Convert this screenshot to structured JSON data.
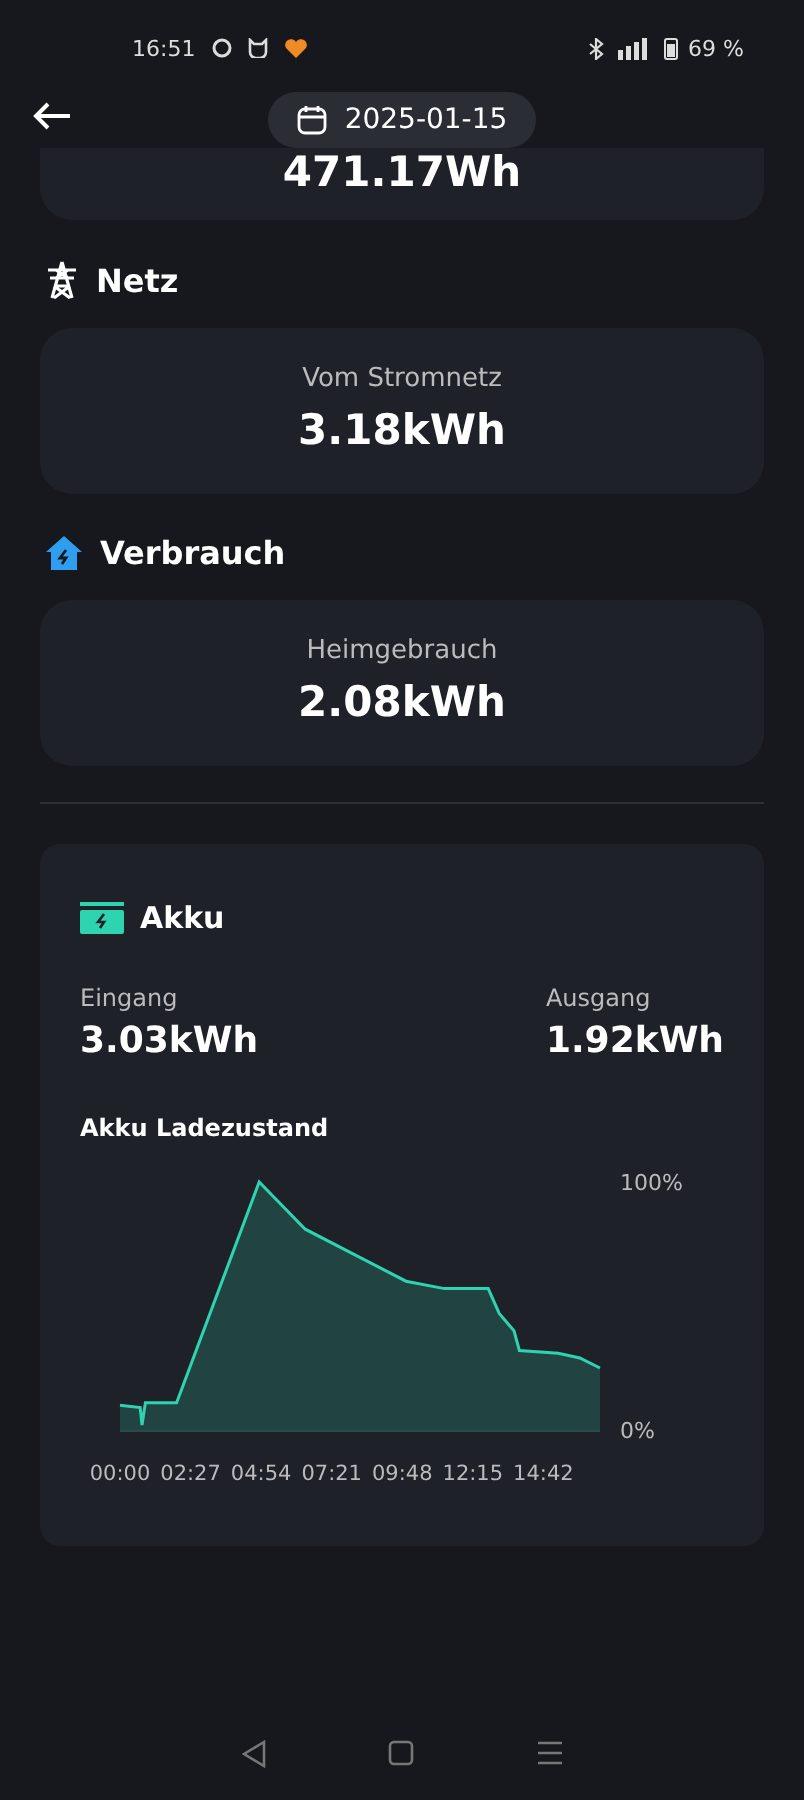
{
  "status_bar": {
    "time": "16:51",
    "battery": "69 %"
  },
  "header": {
    "date": "2025-01-15"
  },
  "top_card": {
    "value": "471.17Wh"
  },
  "sections": [
    {
      "kind": "grid",
      "title": "Netz",
      "label": "Vom Stromnetz",
      "value": "3.18kWh"
    },
    {
      "kind": "home",
      "title": "Verbrauch",
      "label": "Heimgebrauch",
      "value": "2.08kWh"
    }
  ],
  "battery": {
    "title": "Akku",
    "stats": [
      {
        "label": "Eingang",
        "value": "3.03kWh"
      },
      {
        "label": "Ausgang",
        "value": "1.92kWh"
      }
    ],
    "chart_title": "Akku Ladezustand",
    "chart_data": {
      "type": "area",
      "x": [
        0,
        42,
        46,
        53,
        118,
        290,
        386,
        596,
        676,
        767,
        790,
        821,
        832,
        913,
        958,
        1000
      ],
      "series": [
        {
          "color": "#2ed3b0",
          "values": [
            0.1,
            0.09,
            0.02,
            0.11,
            0.11,
            1.0,
            0.81,
            0.6,
            0.57,
            0.57,
            0.47,
            0.4,
            0.32,
            0.31,
            0.29,
            0.25
          ]
        }
      ],
      "xlim": [
        0,
        1000
      ],
      "ylim": [
        0,
        1
      ],
      "xticks": [
        {
          "value": 0,
          "label": "00:00"
        },
        {
          "value": 147,
          "label": "02:27"
        },
        {
          "value": 294,
          "label": "04:54"
        },
        {
          "value": 441,
          "label": "07:21"
        },
        {
          "value": 588,
          "label": "09:48"
        },
        {
          "value": 735,
          "label": "12:15"
        },
        {
          "value": 882,
          "label": "14:42"
        }
      ],
      "yticks": [
        {
          "value": 0,
          "label": "0%"
        },
        {
          "value": 1,
          "label": "100%"
        }
      ]
    }
  }
}
